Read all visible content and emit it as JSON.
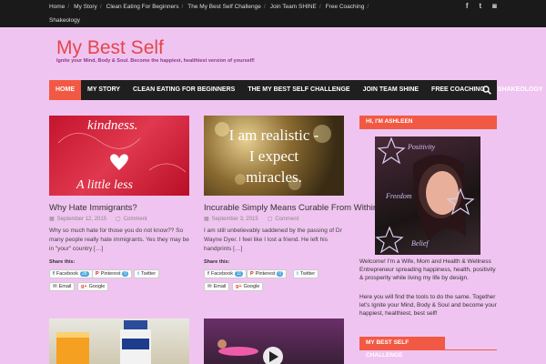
{
  "topbar": {
    "links": [
      "Home",
      "My Story",
      "Clean Eating For Beginners",
      "The My Best Self Challenge",
      "Join Team SHINE",
      "Free Coaching"
    ],
    "second_row": "Shakeology",
    "social": [
      "facebook-icon",
      "twitter-icon",
      "instagram-icon"
    ]
  },
  "header": {
    "title": "My Best Self",
    "tagline": "Ignite your Mind, Body & Soul. Become the happiest, healthiest version of yourself!"
  },
  "nav": {
    "items": [
      "HOME",
      "MY STORY",
      "CLEAN EATING FOR BEGINNERS",
      "THE MY BEST SELF CHALLENGE",
      "JOIN TEAM SHINE",
      "FREE COACHING",
      "SHAKEOLOGY"
    ]
  },
  "posts": [
    {
      "image_text": [
        "kindness.",
        "A little less"
      ],
      "title": "Why Hate Immigrants?",
      "date": "September 12, 2015",
      "comment": "Comment",
      "excerpt": "Why so much hate for those you do not know?? So many people really hate immigrants. Yes they may be in \"your\" country […]",
      "share_label": "Share this:",
      "facebook": "Facebook",
      "facebook_count": "28",
      "pinterest": "Pinterest",
      "pinterest_count": "0",
      "twitter": "Twitter",
      "email": "Email",
      "google": "Google"
    },
    {
      "image_text": [
        "I am realistic -",
        "I expect",
        "miracles."
      ],
      "title": "Incurable Simply Means Curable From Within",
      "date": "September 3, 2015",
      "comment": "Comment",
      "excerpt": "I am still unbelievably saddened by the passing of Dr Wayne Dyer. I feel like I lost a friend. He left his handprints […]",
      "share_label": "Share this:",
      "facebook": "Facebook",
      "facebook_count": "11",
      "pinterest": "Pinterest",
      "pinterest_count": "0",
      "twitter": "Twitter",
      "email": "Email",
      "google": "Google"
    }
  ],
  "sidebar": {
    "widget1_title": "HI, I'M ASHLEEN",
    "photo_words": [
      "Positivity",
      "Freedom",
      "Belief"
    ],
    "bio1": "Welcome! I'm a Wife, Mom and Health & Wellness Entrepreneur spreading happiness, health, positivity & prosperity while living my life by design.",
    "bio2": "Here you will find the tools to do the same. Together let's Ignite your Mind, Body & Soul and become your happiest, healthiest, best self!",
    "widget2_title": "MY BEST SELF CHALLENGE"
  },
  "colors": {
    "background": "#f0c4f0",
    "accent": "#f25944",
    "title": "#e2474a",
    "nav": "#1f1f1f"
  }
}
